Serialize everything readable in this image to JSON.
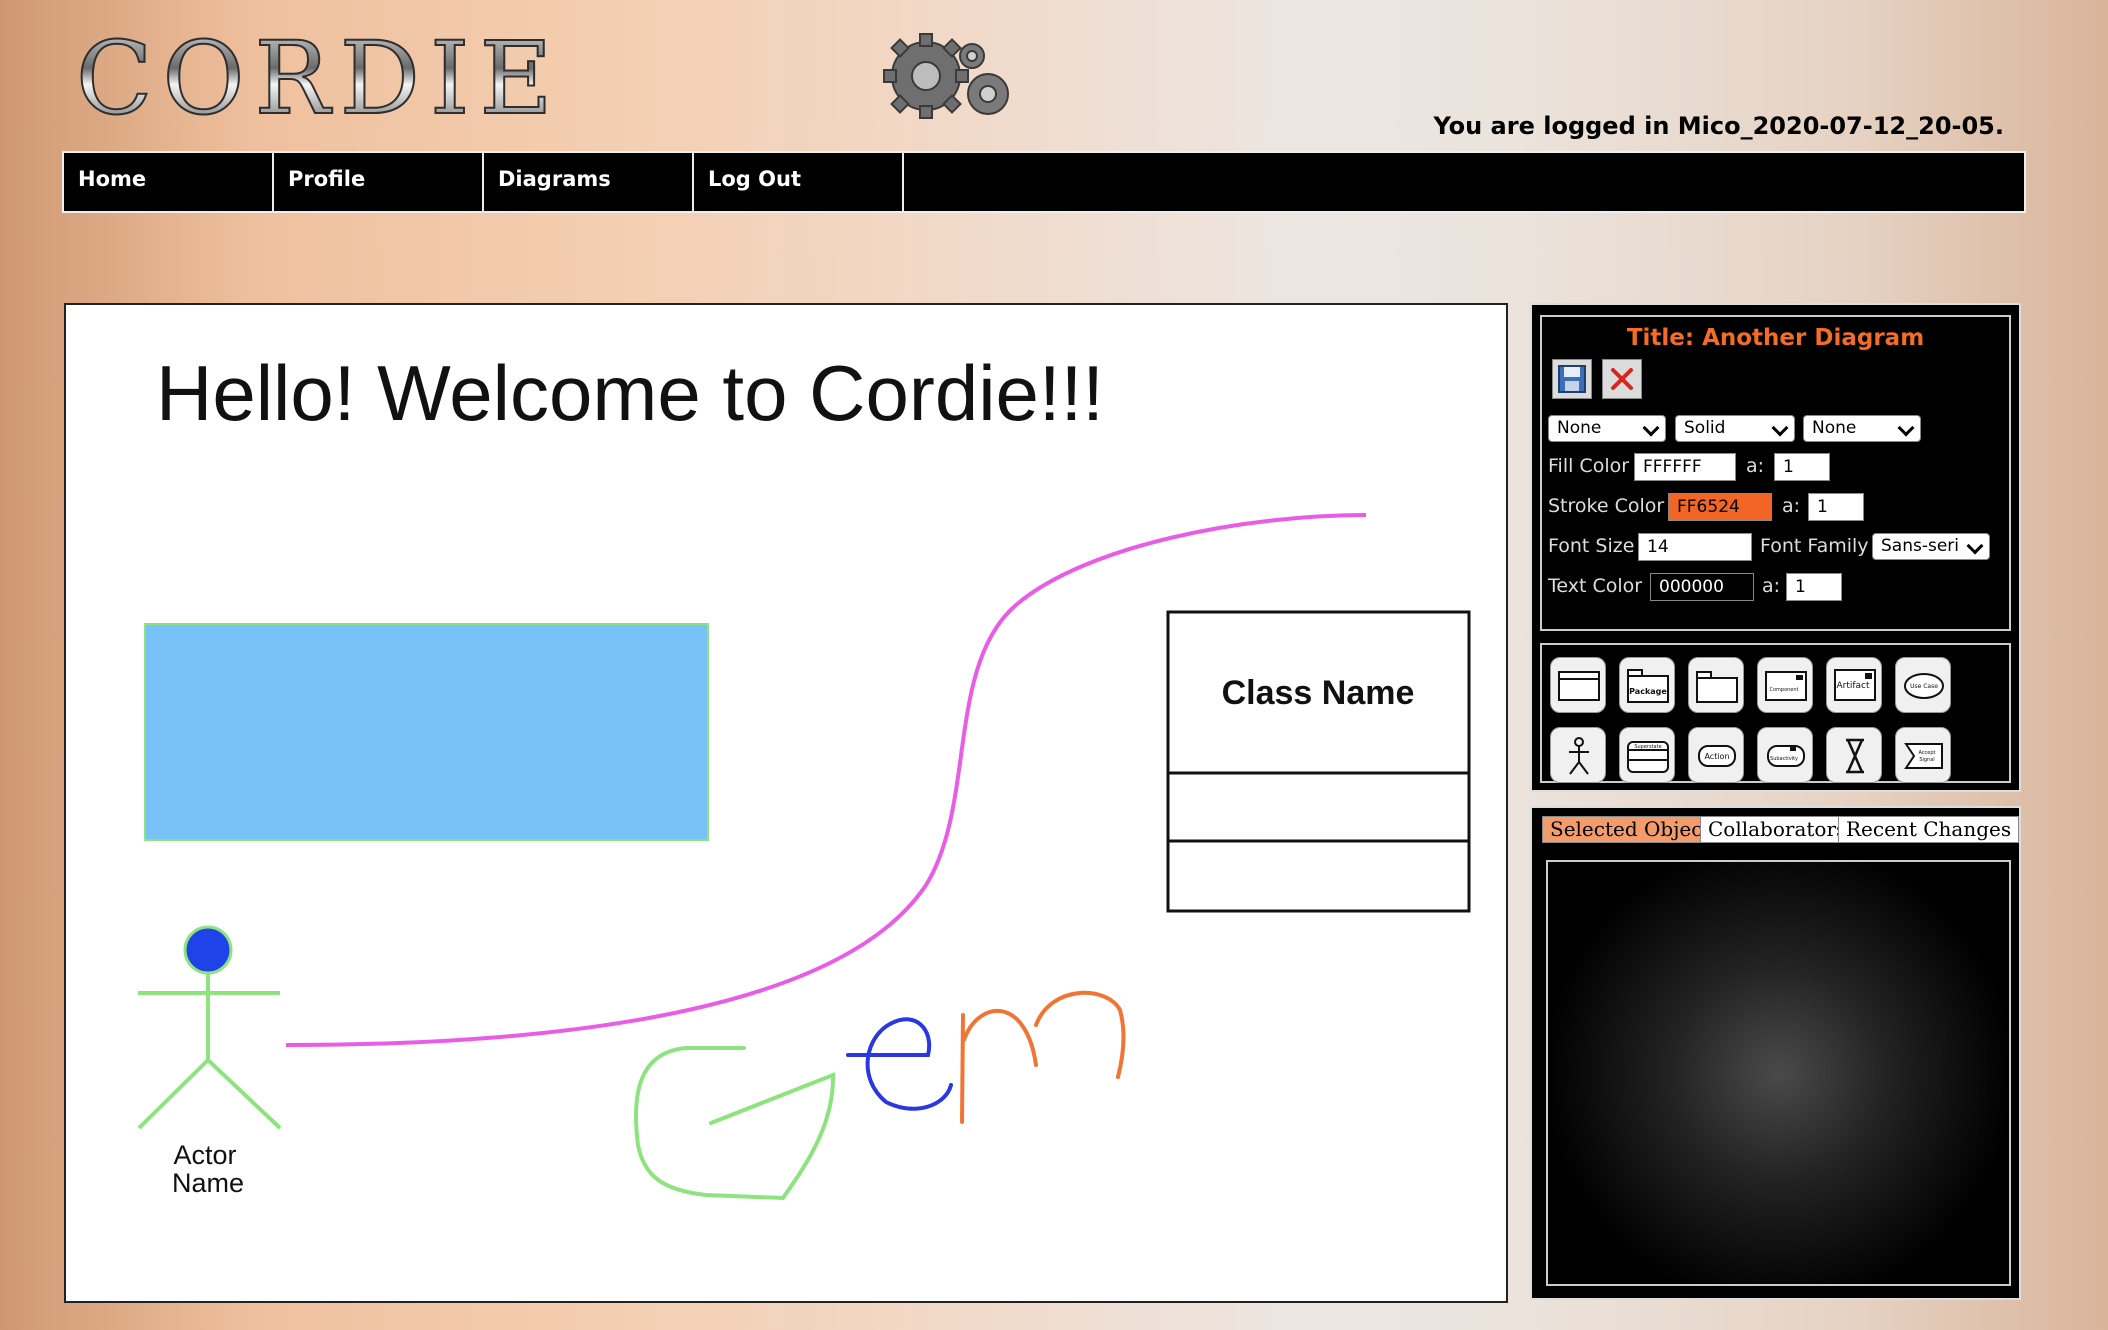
{
  "header": {
    "logo_text": "CORDIE",
    "login_status": "You are logged in Mico_2020-07-12_20-05."
  },
  "nav": {
    "items": [
      {
        "label": "Home"
      },
      {
        "label": "Profile"
      },
      {
        "label": "Diagrams"
      },
      {
        "label": "Log Out"
      }
    ]
  },
  "canvas": {
    "heading": "Hello! Welcome to Cordie!!!",
    "class_box_name": "Class Name",
    "actor_label_line1": "Actor",
    "actor_label_line2": "Name",
    "colors": {
      "rectangle_fill": "#77c1f7",
      "rectangle_stroke": "#8de47f",
      "connector": "#e85ce6",
      "actor_head": "#1f43e8",
      "actor_body": "#8de47f",
      "scribble_green": "#8de47f",
      "scribble_blue": "#2b37e0",
      "scribble_orange": "#f07534"
    }
  },
  "properties": {
    "title": "Title: Another Diagram",
    "icons": {
      "save": "floppy-disk-icon",
      "delete": "red-x-icon"
    },
    "start_arrow": "None",
    "line_style": "Solid",
    "end_arrow": "None",
    "fill_color_label": "Fill Color",
    "fill_color": "FFFFFF",
    "fill_alpha_label": "a:",
    "fill_alpha": "1",
    "stroke_color_label": "Stroke Color",
    "stroke_color": "FF6524",
    "stroke_alpha_label": "a:",
    "stroke_alpha": "1",
    "font_size_label": "Font Size",
    "font_size": "14",
    "font_family_label": "Font Family",
    "font_family": "Sans-seri",
    "text_color_label": "Text Color",
    "text_color": "000000",
    "text_alpha_label": "a:",
    "text_alpha": "1"
  },
  "shape_palette": {
    "labels": {
      "package": "Package",
      "component": "Component",
      "artifact": "Artifact",
      "use_case": "Use Case",
      "superstate": "Superstate",
      "action": "Action",
      "subactivity": "Subactivity",
      "accept_signal_1": "Accept",
      "accept_signal_2": "Signal"
    }
  },
  "tabs": {
    "items": [
      {
        "label": "Selected Object"
      },
      {
        "label": "Collaborators"
      },
      {
        "label": "Recent Changes"
      }
    ]
  }
}
